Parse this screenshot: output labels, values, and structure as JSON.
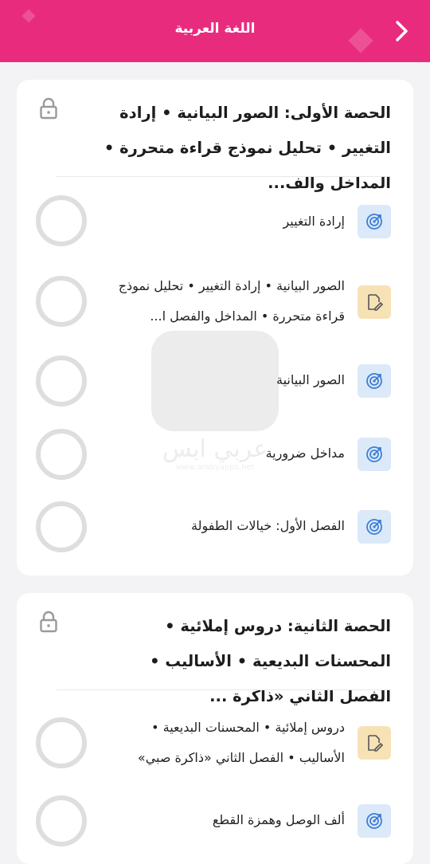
{
  "header": {
    "title": "اللغة العربية",
    "bg_color": "#e92b7e"
  },
  "watermark": {
    "brand_text": "عربي ابس",
    "sub_text": "www.arabyapps.net"
  },
  "sections": [
    {
      "title": "الحصة الأولى: الصور البيانية • إرادة التغيير • تحليل نموذج قراءة متحررة • المداخل والف...",
      "locked": true,
      "lessons": [
        {
          "type": "target",
          "label": "إرادة التغيير"
        },
        {
          "type": "note",
          "label": "الصور البيانية • إرادة التغيير • تحليل نموذج قراءة متحررة • المداخل والفصل ا..."
        },
        {
          "type": "target",
          "label": "الصور البيانية"
        },
        {
          "type": "target",
          "label": "مداخل ضرورية"
        },
        {
          "type": "target",
          "label": "الفصل الأول: خيالات الطفولة"
        }
      ]
    },
    {
      "title": "الحصة الثانية: دروس إملائية • المحسنات البديعية • الأساليب • الفصل الثاني «ذاكرة ...",
      "locked": true,
      "lessons": [
        {
          "type": "note",
          "label": "دروس إملائية • المحسنات البديعية • الأساليب • الفصل الثاني «ذاكرة صبي»"
        },
        {
          "type": "target",
          "label": "ألف الوصل وهمزة القطع"
        }
      ]
    }
  ]
}
